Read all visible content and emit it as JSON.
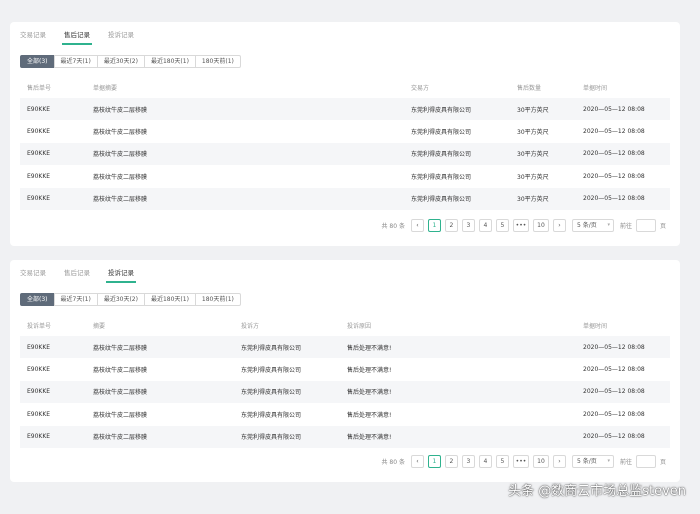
{
  "card1": {
    "tabs": [
      {
        "label": "交易记录",
        "active": false
      },
      {
        "label": "售后记录",
        "active": true
      },
      {
        "label": "投诉记录",
        "active": false
      }
    ],
    "filters": [
      {
        "label": "全部(3)",
        "active": true
      },
      {
        "label": "最近7天(1)",
        "active": false
      },
      {
        "label": "最近30天(2)",
        "active": false
      },
      {
        "label": "最近180天(1)",
        "active": false
      },
      {
        "label": "180天前(1)",
        "active": false
      }
    ],
    "columns": [
      "售后单号",
      "单据摘要",
      "交易方",
      "售后数量",
      "单据时间"
    ],
    "rows": [
      [
        "E90KKE",
        "荔枝纹牛皮二层移膜",
        "东莞利得皮具有限公司",
        "30平方英尺",
        "2020—05—12 08:08"
      ],
      [
        "E90KKE",
        "荔枝纹牛皮二层移膜",
        "东莞利得皮具有限公司",
        "30平方英尺",
        "2020—05—12 08:08"
      ],
      [
        "E90KKE",
        "荔枝纹牛皮二层移膜",
        "东莞利得皮具有限公司",
        "30平方英尺",
        "2020—05—12 08:08"
      ],
      [
        "E90KKE",
        "荔枝纹牛皮二层移膜",
        "东莞利得皮具有限公司",
        "30平方英尺",
        "2020—05—12 08:08"
      ],
      [
        "E90KKE",
        "荔枝纹牛皮二层移膜",
        "东莞利得皮具有限公司",
        "30平方英尺",
        "2020—05—12 08:08"
      ]
    ],
    "pagination": {
      "total": "共 80 条",
      "prev": "‹",
      "pages": [
        "1",
        "2",
        "3",
        "4",
        "5",
        "•••",
        "10"
      ],
      "current": "1",
      "next": "›",
      "page_size": "5 条/页",
      "goto_label": "前往",
      "goto_unit": "页"
    }
  },
  "card2": {
    "tabs": [
      {
        "label": "交易记录",
        "active": false
      },
      {
        "label": "售后记录",
        "active": false
      },
      {
        "label": "投诉记录",
        "active": true
      }
    ],
    "filters": [
      {
        "label": "全部(3)",
        "active": true
      },
      {
        "label": "最近7天(1)",
        "active": false
      },
      {
        "label": "最近30天(2)",
        "active": false
      },
      {
        "label": "最近180天(1)",
        "active": false
      },
      {
        "label": "180天前(1)",
        "active": false
      }
    ],
    "columns": [
      "投诉单号",
      "摘要",
      "投诉方",
      "投诉原因",
      "单据时间"
    ],
    "rows": [
      [
        "E90KKE",
        "荔枝纹牛皮二层移膜",
        "东莞利得皮具有限公司",
        "售后处理不满意!",
        "2020—05—12 08:08"
      ],
      [
        "E90KKE",
        "荔枝纹牛皮二层移膜",
        "东莞利得皮具有限公司",
        "售后处理不满意!",
        "2020—05—12 08:08"
      ],
      [
        "E90KKE",
        "荔枝纹牛皮二层移膜",
        "东莞利得皮具有限公司",
        "售后处理不满意!",
        "2020—05—12 08:08"
      ],
      [
        "E90KKE",
        "荔枝纹牛皮二层移膜",
        "东莞利得皮具有限公司",
        "售后处理不满意!",
        "2020—05—12 08:08"
      ],
      [
        "E90KKE",
        "荔枝纹牛皮二层移膜",
        "东莞利得皮具有限公司",
        "售后处理不满意!",
        "2020—05—12 08:08"
      ]
    ],
    "pagination": {
      "total": "共 80 条",
      "prev": "‹",
      "pages": [
        "1",
        "2",
        "3",
        "4",
        "5",
        "•••",
        "10"
      ],
      "current": "1",
      "next": "›",
      "page_size": "5 条/页",
      "goto_label": "前往",
      "goto_unit": "页"
    }
  },
  "watermark": "头条 @数商云市场总监steven",
  "colors": {
    "accent": "#2fb28e",
    "filter_active": "#5f6b7a",
    "background": "#f0f1f3"
  }
}
